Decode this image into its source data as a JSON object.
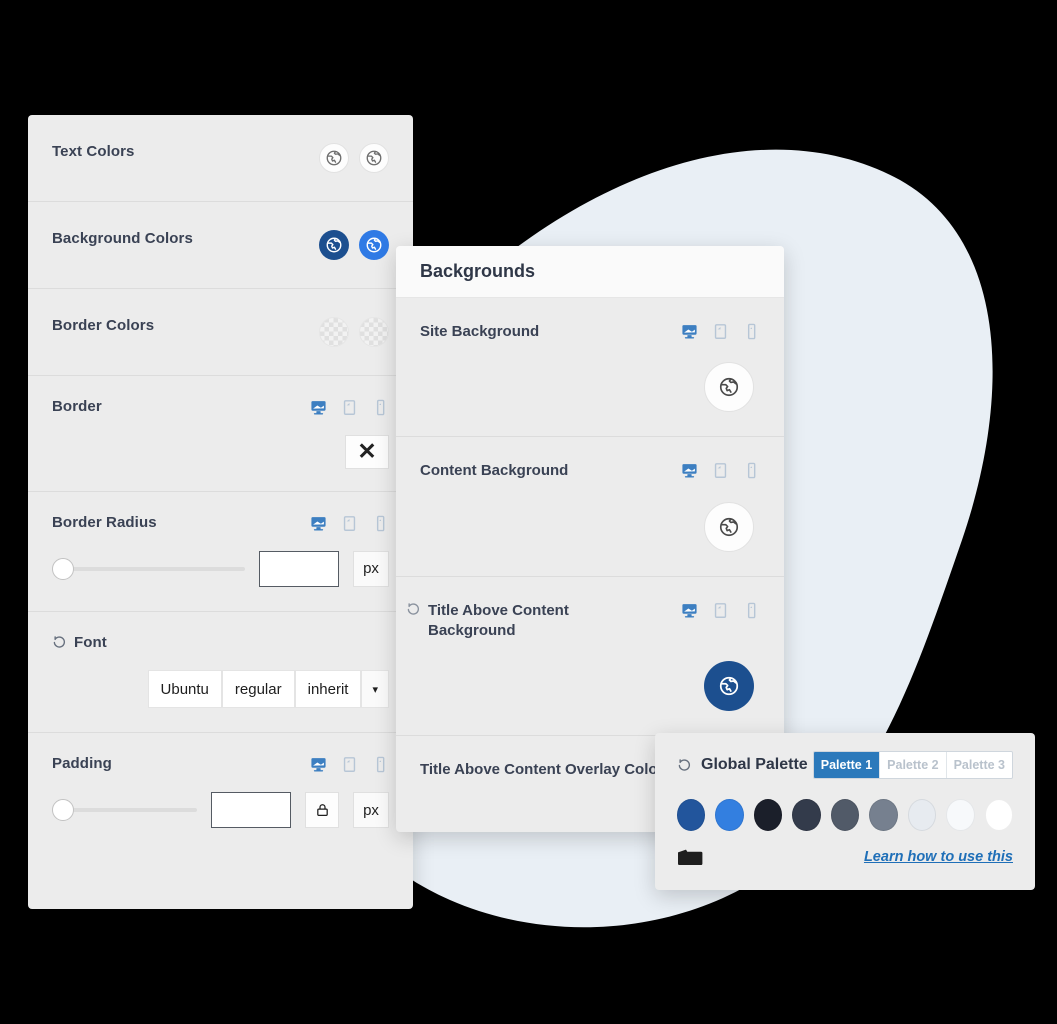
{
  "theme": {
    "page_background": "#000000",
    "blob_color": "#e9eff5",
    "panel_background": "#ececec",
    "label_color": "#3a4254",
    "accent_blue": "#2b79bb",
    "navy": "#1c4f8f",
    "bright_blue": "#2f7ae5"
  },
  "styles_panel": {
    "rows": [
      {
        "label": "Text Colors",
        "swatches": [
          {
            "name": "text-color-swatch-1",
            "style": "plain",
            "icon": "globe-icon"
          },
          {
            "name": "text-color-swatch-2",
            "style": "plain",
            "icon": "globe-icon"
          }
        ]
      },
      {
        "label": "Background Colors",
        "swatches": [
          {
            "name": "background-color-swatch-1",
            "style": "navy",
            "icon": "globe-icon"
          },
          {
            "name": "background-color-swatch-2",
            "style": "blue",
            "icon": "globe-icon"
          }
        ]
      },
      {
        "label": "Border Colors",
        "swatches": [
          {
            "name": "border-color-swatch-1",
            "style": "transparent-checker",
            "icon": "none"
          },
          {
            "name": "border-color-swatch-2",
            "style": "transparent-checker",
            "icon": "none"
          }
        ]
      }
    ],
    "border": {
      "label": "Border",
      "devices": [
        "desktop-icon",
        "tablet-icon",
        "mobile-icon"
      ],
      "active_device": "desktop-icon",
      "clear_button": "✕"
    },
    "border_radius": {
      "label": "Border Radius",
      "devices": [
        "desktop-icon",
        "tablet-icon",
        "mobile-icon"
      ],
      "active_device": "desktop-icon",
      "slider_value": 0,
      "slider_min": 0,
      "slider_max": 100,
      "input_value": "",
      "unit": "px"
    },
    "font": {
      "label": "Font",
      "has_reset": true,
      "family": "Ubuntu",
      "weight": "regular",
      "style": "inherit",
      "caret": "▾"
    },
    "padding": {
      "label": "Padding",
      "devices": [
        "desktop-icon",
        "tablet-icon",
        "mobile-icon"
      ],
      "active_device": "desktop-icon",
      "slider_value": 0,
      "slider_min": 0,
      "slider_max": 100,
      "input_value": "",
      "lock_icon": "lock-icon",
      "unit": "px"
    }
  },
  "backgrounds_panel": {
    "title": "Backgrounds",
    "rows": [
      {
        "label": "Site Background",
        "has_reset": false,
        "devices": [
          "desktop-icon",
          "tablet-icon",
          "mobile-icon"
        ],
        "active_device": "desktop-icon",
        "swatch_style": "plain",
        "swatch_name": "site-background-color-button"
      },
      {
        "label": "Content Background",
        "has_reset": false,
        "devices": [
          "desktop-icon",
          "tablet-icon",
          "mobile-icon"
        ],
        "active_device": "desktop-icon",
        "swatch_style": "plain",
        "swatch_name": "content-background-color-button"
      },
      {
        "label": "Title Above Content Background",
        "has_reset": true,
        "devices": [
          "desktop-icon",
          "tablet-icon",
          "mobile-icon"
        ],
        "active_device": "desktop-icon",
        "swatch_style": "navy",
        "swatch_name": "title-above-content-background-color-button"
      },
      {
        "label": "Title Above Content Overlay Color",
        "has_reset": false,
        "devices": [],
        "active_device": "",
        "swatch_style": "none",
        "swatch_name": "title-above-content-overlay-color-button"
      }
    ]
  },
  "palette_panel": {
    "title": "Global Palette",
    "has_reset": true,
    "tabs": [
      {
        "label": "Palette 1",
        "active": true
      },
      {
        "label": "Palette 2",
        "active": false
      },
      {
        "label": "Palette 3",
        "active": false
      }
    ],
    "swatches": [
      "#22559c",
      "#337fe0",
      "#1b1f2a",
      "#333b4b",
      "#515a68",
      "#76808f",
      "#e7ebf0",
      "#f7f9fb",
      "#ffffff"
    ],
    "folder_icon": "folder-icon",
    "link_text": "Learn how to use this"
  }
}
